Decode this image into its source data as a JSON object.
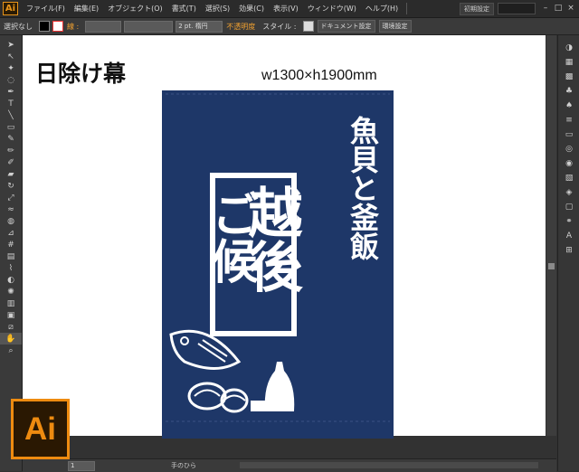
{
  "app": {
    "badge": "Ai"
  },
  "menu": {
    "items": [
      "ファイル(F)",
      "編集(E)",
      "オブジェクト(O)",
      "書式(T)",
      "選択(S)",
      "効果(C)",
      "表示(V)",
      "ウィンドウ(W)",
      "ヘルプ(H)"
    ],
    "workspace": "初期設定"
  },
  "control_bar": {
    "selection": "選択なし",
    "stroke_label": "線 :",
    "stroke_size": "2 pt. 楕円",
    "opacity_label": "不透明度",
    "style_label": "スタイル :",
    "doc_setup": "ドキュメント設定",
    "prefs": "環境設定"
  },
  "artboard": {
    "title": "日除け幕",
    "dimensions": "w1300×h1900mm",
    "banner": {
      "line1": "魚貝と釜飯",
      "line2": "越後",
      "line3": "ご候"
    }
  },
  "status": {
    "zoom": "1",
    "text": "手のひら"
  },
  "colors": {
    "banner": "#1e3768",
    "accent": "#ee8b10"
  },
  "tools": [
    "select",
    "direct-select",
    "magic-wand",
    "lasso",
    "pen",
    "type",
    "line",
    "rect",
    "brush",
    "pencil",
    "blob",
    "eraser",
    "rotate",
    "scale",
    "warp",
    "shape-builder",
    "perspective",
    "mesh",
    "gradient",
    "eyedropper",
    "blend",
    "symbol",
    "graph",
    "artboard",
    "slice",
    "hand",
    "zoom"
  ],
  "panels": [
    "color",
    "guide",
    "swatches",
    "brushes",
    "symbols",
    "stroke",
    "gradient",
    "transparency",
    "appearance",
    "graphic-styles",
    "layers",
    "artboards",
    "links",
    "type",
    "align"
  ]
}
